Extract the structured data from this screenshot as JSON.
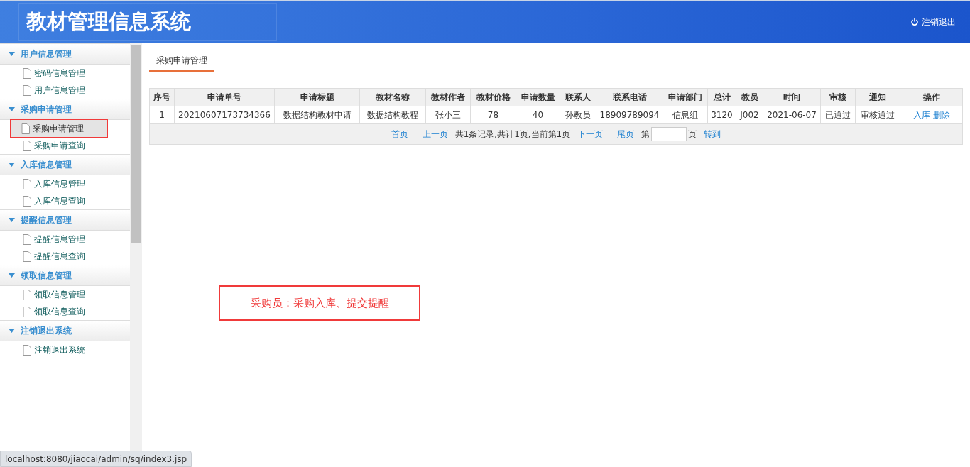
{
  "header": {
    "title": "教材管理信息系统",
    "logout": "注销退出"
  },
  "sidebar": {
    "groups": [
      {
        "label": "用户信息管理",
        "expanded": true,
        "items": [
          {
            "label": "密码信息管理",
            "selected": false
          },
          {
            "label": "用户信息管理",
            "selected": false
          }
        ]
      },
      {
        "label": "采购申请管理",
        "expanded": true,
        "items": [
          {
            "label": "采购申请管理",
            "selected": true
          },
          {
            "label": "采购申请查询",
            "selected": false
          }
        ]
      },
      {
        "label": "入库信息管理",
        "expanded": true,
        "items": [
          {
            "label": "入库信息管理",
            "selected": false
          },
          {
            "label": "入库信息查询",
            "selected": false
          }
        ]
      },
      {
        "label": "提醒信息管理",
        "expanded": true,
        "items": [
          {
            "label": "提醒信息管理",
            "selected": false
          },
          {
            "label": "提醒信息查询",
            "selected": false
          }
        ]
      },
      {
        "label": "领取信息管理",
        "expanded": true,
        "items": [
          {
            "label": "领取信息管理",
            "selected": false
          },
          {
            "label": "领取信息查询",
            "selected": false
          }
        ]
      },
      {
        "label": "注销退出系统",
        "expanded": true,
        "items": [
          {
            "label": "注销退出系统",
            "selected": false
          }
        ]
      }
    ]
  },
  "tabs": [
    {
      "label": "采购申请管理",
      "selected": true
    }
  ],
  "table": {
    "columns": [
      "序号",
      "申请单号",
      "申请标题",
      "教材名称",
      "教材作者",
      "教材价格",
      "申请数量",
      "联系人",
      "联系电话",
      "申请部门",
      "总计",
      "教员",
      "时间",
      "审核",
      "通知",
      "操作"
    ],
    "rows": [
      {
        "cells": [
          "1",
          "20210607173734366",
          "数据结构教材申请",
          "数据结构教程",
          "张小三",
          "78",
          "40",
          "孙教员",
          "18909789094",
          "信息组",
          "3120",
          "J002",
          "2021-06-07",
          "已通过",
          "审核通过"
        ],
        "actions": [
          "入库",
          "删除"
        ]
      }
    ]
  },
  "pagination": [
    {
      "kind": "link",
      "text": "首页"
    },
    {
      "kind": "link",
      "text": "上一页"
    },
    {
      "kind": "text",
      "text": "共1条记录,共计1页,当前第1页"
    },
    {
      "kind": "link",
      "text": "下一页"
    },
    {
      "kind": "link",
      "text": "尾页"
    },
    {
      "kind": "text",
      "text": "第"
    },
    {
      "kind": "input"
    },
    {
      "kind": "text",
      "text": "页"
    },
    {
      "kind": "link",
      "text": "转到"
    }
  ],
  "note": "采购员：采购入库、提交提醒",
  "status_url": "localhost:8080/jiaocai/admin/sq/index3.jsp"
}
